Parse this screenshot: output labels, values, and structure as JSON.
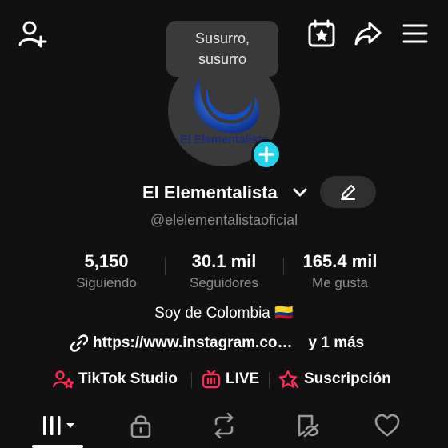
{
  "tooltip": {
    "line1": "Susurro,",
    "line2": "susurro"
  },
  "avatar": {
    "logo_text": "El Elementalista"
  },
  "profile": {
    "display_name": "El Elementalista",
    "handle": "@elelementalistaoficial"
  },
  "stats": [
    {
      "value": "5,150",
      "label": "Siguiendo"
    },
    {
      "value": "30.1 mil",
      "label": "Seguidores"
    },
    {
      "value": "165.4 mil",
      "label": "Me gusta"
    }
  ],
  "bio": "Soy de Colombia 🇨🇴",
  "link": {
    "url": "https://www.instagram.co…",
    "more": "y 1 más"
  },
  "chips": [
    {
      "label": "TikTok Studio",
      "icon": "person-star-icon"
    },
    {
      "label": "LIVE",
      "icon": "live-tv-icon"
    },
    {
      "label": "Suscripción",
      "icon": "subscription-star-icon"
    }
  ],
  "tabs": [
    {
      "name": "videos-grid",
      "icon": "grid-columns-icon"
    },
    {
      "name": "private",
      "icon": "lock-icon"
    },
    {
      "name": "reposts",
      "icon": "repost-icon"
    },
    {
      "name": "favorites",
      "icon": "hidden-liked-icon"
    },
    {
      "name": "liked",
      "icon": "heart-icon"
    }
  ],
  "colors": {
    "background": "#111111",
    "accent_cyan": "#20d5ec",
    "accent_pink": "#fe2c55",
    "muted_text": "#8e8e8e"
  }
}
